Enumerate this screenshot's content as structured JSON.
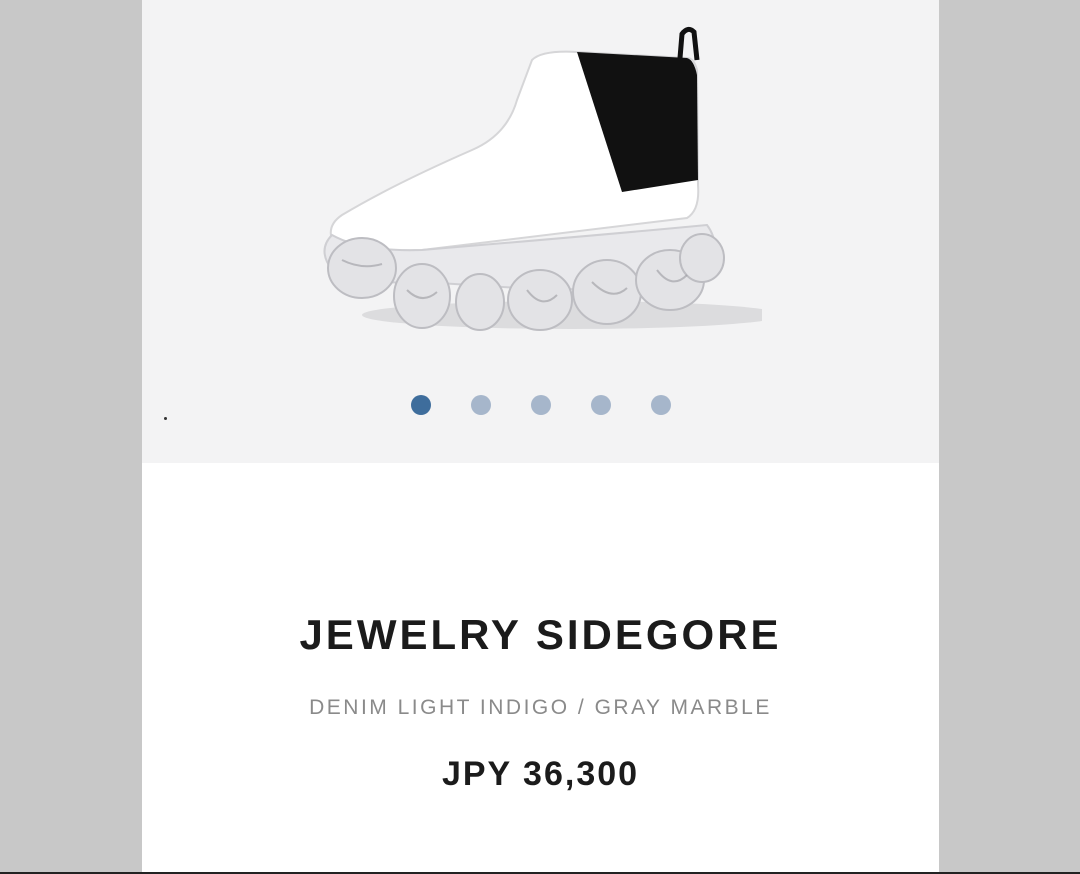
{
  "product": {
    "name": "JEWELRY SIDEGORE",
    "color": "DENIM LIGHT INDIGO / GRAY MARBLE",
    "price": "JPY 36,300"
  },
  "gallery": {
    "image_icon": "boot-photo",
    "slide_count": 5,
    "active_slide": 1
  },
  "colors": {
    "dot_active": "#3e6d9c",
    "dot_inactive": "#a6b6cb"
  }
}
